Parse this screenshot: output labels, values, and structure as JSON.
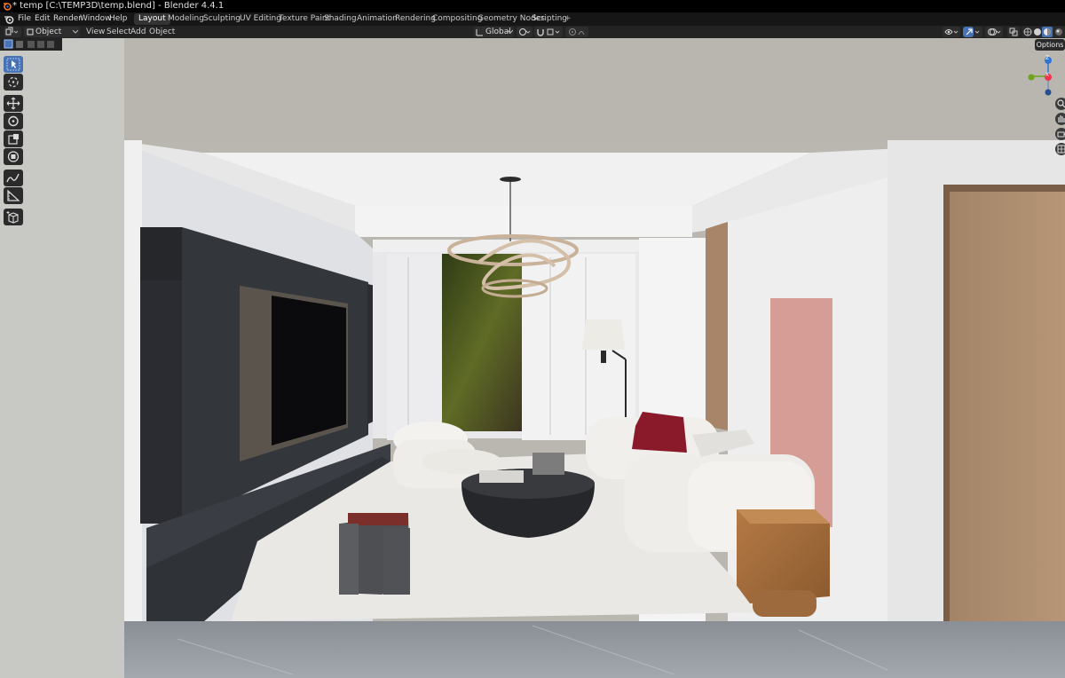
{
  "window": {
    "title": "* temp [C:\\TEMP3D\\temp.blend] - Blender 4.4.1"
  },
  "menu": {
    "items": [
      "File",
      "Edit",
      "Render",
      "Window",
      "Help"
    ]
  },
  "workspaces": [
    "Layout",
    "Modeling",
    "Sculpting",
    "UV Editing",
    "Texture Paint",
    "Shading",
    "Animation",
    "Rendering",
    "Compositing",
    "Geometry Nodes",
    "Scripting"
  ],
  "active_workspace": "Layout",
  "add_workspace_label": "+",
  "header": {
    "mode": "Object Mode",
    "menus": [
      "View",
      "Select",
      "Add",
      "Object"
    ],
    "transform_orientation": "Global",
    "options_label": "Options"
  },
  "gizmo": {
    "z_label": "Z",
    "x_label": "X"
  },
  "toolbar": {
    "tools": [
      "select-box",
      "cursor",
      "move",
      "rotate",
      "scale",
      "transform",
      "annotate",
      "measure",
      "add-cube"
    ],
    "active_tool": "select-box"
  },
  "colors": {
    "accent": "#4772b3",
    "x_axis": "#f0344e",
    "y_axis": "#6fa31a",
    "z_axis": "#2f75d8"
  }
}
